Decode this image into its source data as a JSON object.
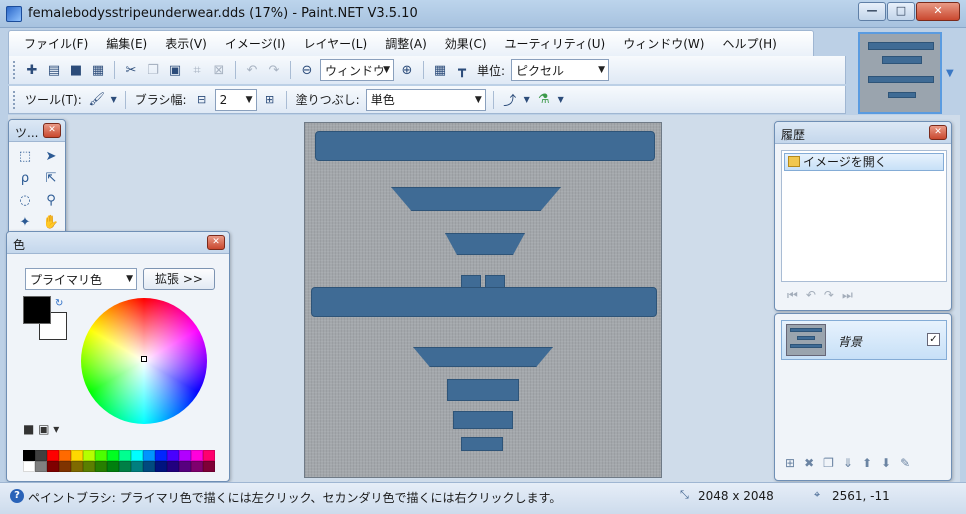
{
  "window": {
    "title": "femalebodysstripeunderwear.dds (17%) - Paint.NET V3.5.10",
    "minimize_glyph": "—",
    "maximize_glyph": "□",
    "close_glyph": "✕"
  },
  "menu": [
    "ファイル(F)",
    "編集(E)",
    "表示(V)",
    "イメージ(I)",
    "レイヤー(L)",
    "調整(A)",
    "効果(C)",
    "ユーティリティ(U)",
    "ウィンドウ(W)",
    "ヘルプ(H)"
  ],
  "toolbar1": {
    "zoom_value": "ウィンドウ",
    "unit_label": "単位:",
    "unit_value": "ピクセル"
  },
  "toolbar2": {
    "tool_label": "ツール(T):",
    "brush_width_label": "ブラシ幅:",
    "brush_width_value": "2",
    "fill_label": "塗りつぶし:",
    "fill_value": "単色"
  },
  "tools_window": {
    "title": "ツ..."
  },
  "colors_window": {
    "title": "色",
    "mode_value": "プライマリ色",
    "expand_label": "拡張 >>",
    "palette": [
      "#000000",
      "#404040",
      "#ff0000",
      "#ff6a00",
      "#ffd800",
      "#b6ff00",
      "#4cff00",
      "#00ff21",
      "#00ff90",
      "#00ffff",
      "#0094ff",
      "#0026ff",
      "#4800ff",
      "#b200ff",
      "#ff00dc",
      "#ff006e",
      "#ffffff",
      "#808080",
      "#7f0000",
      "#7f3300",
      "#7f6a00",
      "#5b7f00",
      "#267f00",
      "#007f0e",
      "#007f46",
      "#007f7f",
      "#004a7f",
      "#00137f",
      "#21007f",
      "#57007f",
      "#7f006e",
      "#7f0037"
    ]
  },
  "history_window": {
    "title": "履歴",
    "items": [
      "イメージを開く"
    ]
  },
  "layers_window": {
    "layer_name": "背景",
    "layer_visible": "✓"
  },
  "status": {
    "help_glyph": "?",
    "message": "ペイントブラシ: プライマリ色で描くには左クリック、セカンダリ色で描くには右クリックします。",
    "image_size": "2048 x 2048",
    "cursor_position": "2561, -11"
  },
  "colors": {
    "stripe": "#3f6b95",
    "canvas_bg": "#a3a7ab",
    "accent": "#5a9be0"
  }
}
